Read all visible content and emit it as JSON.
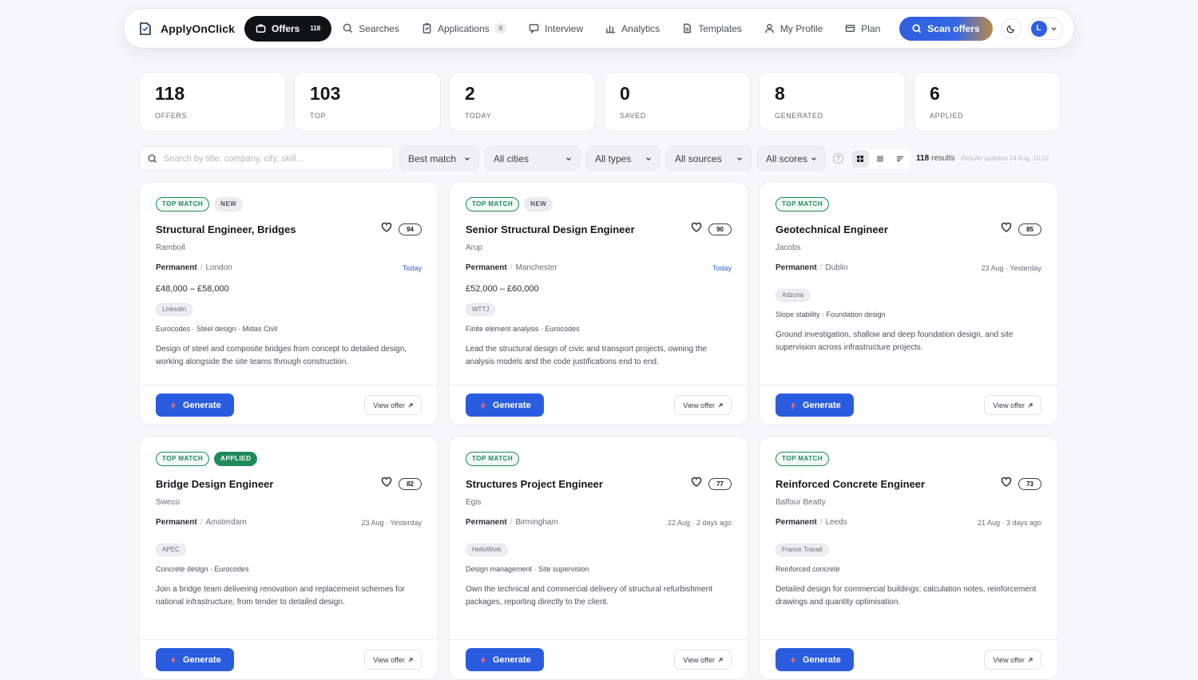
{
  "app": {
    "name": "ApplyOnClick"
  },
  "nav": {
    "offers": {
      "label": "Offers",
      "count": "118"
    },
    "searches": "Searches",
    "applications": {
      "label": "Applications",
      "badge": "8"
    },
    "interview": "Interview",
    "analytics": "Analytics",
    "templates": "Templates",
    "profile": "My Profile",
    "plan": "Plan",
    "scan": "Scan offers",
    "avatar_initial": "L"
  },
  "stats": [
    {
      "value": "118",
      "label": "OFFERS"
    },
    {
      "value": "103",
      "label": "TOP"
    },
    {
      "value": "2",
      "label": "TODAY"
    },
    {
      "value": "0",
      "label": "SAVED"
    },
    {
      "value": "8",
      "label": "GENERATED"
    },
    {
      "value": "6",
      "label": "APPLIED"
    }
  ],
  "filters": {
    "search_placeholder": "Search by title, company, city, skill...",
    "sort": "Best match",
    "cities": "All cities",
    "types": "All types",
    "sources": "All sources",
    "scores": "All scores",
    "help": "?",
    "results_count": "118",
    "results_label": "results",
    "updated": "Results updated 24 Aug, 10:12"
  },
  "card_actions": {
    "generate": "Generate",
    "view": "View offer"
  },
  "offers": [
    {
      "tags": [
        "TOP MATCH",
        "NEW"
      ],
      "title": "Structural Engineer, Bridges",
      "score": "94",
      "company": "Ramboll",
      "contract": "Permanent",
      "city": "London",
      "date": "Today",
      "salary": "£48,000 – £58,000",
      "source": "LinkedIn",
      "skills": "Eurocodes · Steel design · Midas Civil",
      "description": "Design of steel and composite bridges from concept to detailed design, working alongside the site teams through construction."
    },
    {
      "tags": [
        "TOP MATCH",
        "NEW"
      ],
      "title": "Senior Structural Design Engineer",
      "score": "90",
      "company": "Arup",
      "contract": "Permanent",
      "city": "Manchester",
      "date": "Today",
      "salary": "£52,000 – £60,000",
      "source": "WTTJ",
      "skills": "Finite element analysis · Eurocodes",
      "description": "Lead the structural design of civic and transport projects, owning the analysis models and the code justifications end to end."
    },
    {
      "tags": [
        "TOP MATCH"
      ],
      "title": "Geotechnical Engineer",
      "score": "85",
      "company": "Jacobs",
      "contract": "Permanent",
      "city": "Dublin",
      "date": "23 Aug · Yesterday",
      "salary": "",
      "source": "Adzuna",
      "skills": "Slope stability · Foundation design",
      "description": "Ground investigation, shallow and deep foundation design, and site supervision across infrastructure projects."
    },
    {
      "tags": [
        "TOP MATCH",
        "APPLIED"
      ],
      "title": "Bridge Design Engineer",
      "score": "82",
      "company": "Sweco",
      "contract": "Permanent",
      "city": "Amsterdam",
      "date": "23 Aug · Yesterday",
      "salary": "",
      "source": "APEC",
      "skills": "Concrete design · Eurocodes",
      "description": "Join a bridge team delivering renovation and replacement schemes for national infrastructure, from tender to detailed design."
    },
    {
      "tags": [
        "TOP MATCH"
      ],
      "title": "Structures Project Engineer",
      "score": "77",
      "company": "Egis",
      "contract": "Permanent",
      "city": "Birmingham",
      "date": "22 Aug · 2 days ago",
      "salary": "",
      "source": "HelloWork",
      "skills": "Design management · Site supervision",
      "description": "Own the technical and commercial delivery of structural refurbishment packages, reporting directly to the client."
    },
    {
      "tags": [
        "TOP MATCH"
      ],
      "title": "Reinforced Concrete Engineer",
      "score": "73",
      "company": "Balfour Beatty",
      "contract": "Permanent",
      "city": "Leeds",
      "date": "21 Aug · 3 days ago",
      "salary": "",
      "source": "France Travail",
      "skills": "Reinforced concrete",
      "description": "Detailed design for commercial buildings: calculation notes, reinforcement drawings and quantity optimisation."
    }
  ]
}
